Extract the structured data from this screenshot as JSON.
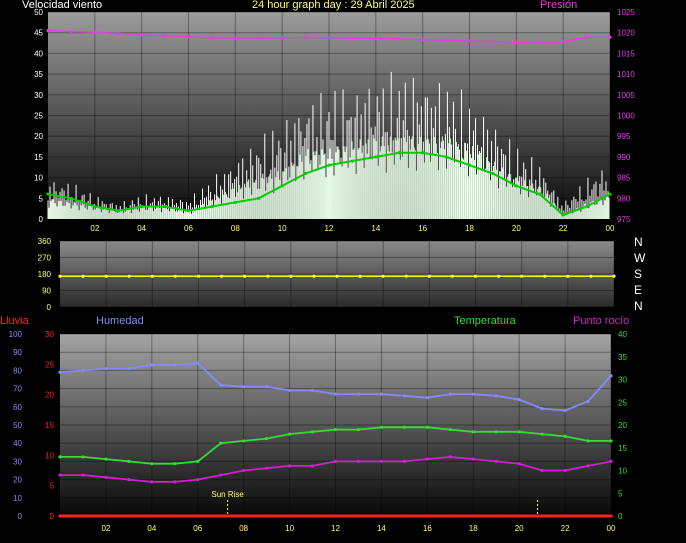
{
  "header": {
    "title": "24 hour graph day : 29 Abril 2025",
    "left_label": "Velocidad viento",
    "right_label": "Presión"
  },
  "labels": {
    "lluvia": "Lluvia",
    "humedad": "Humedad",
    "temperatura": "Temperatura",
    "punto_rocio": "Punto rocío",
    "sunrise": "Sun Rise"
  },
  "colors": {
    "background": "#000000",
    "title": "#ffff66",
    "pressure": "#e040e0",
    "gust": "#ffffff",
    "wind_speed": "#c8f0c8",
    "wind_avg": "#00cc00",
    "direction": "#ffff00",
    "lluvia": "#ff2020",
    "humedad": "#8888ff",
    "temperatura": "#33dd33",
    "punto_rocio": "#d020d0",
    "tick_labels": "#ffff66"
  },
  "compass": [
    "N",
    "W",
    "S",
    "E",
    "N"
  ],
  "chart_data": [
    {
      "type": "line",
      "title": "24 hour graph day : 29 Abril 2025",
      "x_ticks": [
        "02",
        "04",
        "06",
        "08",
        "10",
        "12",
        "14",
        "16",
        "18",
        "20",
        "22",
        "00"
      ],
      "x_hours": [
        0,
        1,
        2,
        3,
        4,
        5,
        6,
        7,
        8,
        9,
        10,
        11,
        12,
        13,
        14,
        15,
        16,
        17,
        18,
        19,
        20,
        21,
        22,
        23,
        24
      ],
      "y_left": {
        "label": "Velocidad viento",
        "ylim": [
          0,
          50
        ],
        "ticks": [
          0,
          5,
          10,
          15,
          20,
          25,
          30,
          35,
          40,
          45,
          50
        ]
      },
      "y_right": {
        "label": "Presión",
        "ylim": [
          975,
          1025
        ],
        "ticks": [
          975,
          980,
          985,
          990,
          995,
          1000,
          1005,
          1010,
          1015,
          1020,
          1025
        ]
      },
      "series": [
        {
          "name": "Presión",
          "axis": "right",
          "values": [
            1020.5,
            1020.3,
            1020.1,
            1019.8,
            1019.5,
            1019.3,
            1019.0,
            1018.8,
            1018.7,
            1018.7,
            1018.8,
            1018.9,
            1018.8,
            1018.7,
            1018.6,
            1018.5,
            1018.3,
            1018.2,
            1018.0,
            1017.9,
            1017.7,
            1017.6,
            1017.8,
            1018.9,
            1018.9
          ]
        },
        {
          "name": "Velocidad viento",
          "axis": "left",
          "values": [
            5,
            4,
            3,
            2,
            3,
            3,
            2,
            5,
            8,
            10,
            12,
            17,
            17,
            19,
            20,
            20,
            20,
            20,
            18,
            14,
            10,
            8,
            1,
            4,
            6
          ]
        },
        {
          "name": "Velocidad viento",
          "axis": "left",
          "values": [
            6,
            5,
            3,
            2,
            3,
            3,
            2,
            3,
            4,
            5,
            8,
            11,
            13,
            14,
            15,
            16,
            16,
            15,
            13,
            11,
            8,
            6,
            1,
            3,
            6
          ]
        },
        {
          "name": "Velocidad viento",
          "axis": "left",
          "values": [
            10,
            9,
            6,
            4,
            6,
            6,
            5,
            10,
            15,
            20,
            24,
            30,
            32,
            33,
            35,
            36,
            36,
            34,
            30,
            25,
            18,
            14,
            4,
            10,
            14
          ]
        }
      ]
    },
    {
      "type": "line",
      "x_ticks": [],
      "y_left": {
        "ylim": [
          0,
          360
        ],
        "ticks": [
          0,
          90,
          180,
          270,
          360
        ]
      },
      "series": [
        {
          "name": "Dirección",
          "values": [
            168,
            168,
            168,
            168,
            168,
            168,
            168,
            168,
            168,
            168,
            168,
            168,
            168,
            168,
            168,
            168,
            168,
            168,
            168,
            168,
            168,
            168,
            168,
            168,
            168
          ]
        }
      ]
    },
    {
      "type": "line",
      "x_ticks": [
        "02",
        "04",
        "06",
        "08",
        "10",
        "12",
        "14",
        "16",
        "18",
        "20",
        "22",
        "00"
      ],
      "x_hours": [
        0,
        1,
        2,
        3,
        4,
        5,
        6,
        7,
        8,
        9,
        10,
        11,
        12,
        13,
        14,
        15,
        16,
        17,
        18,
        19,
        20,
        21,
        22,
        23,
        24
      ],
      "y_axes": {
        "humedad": {
          "label": "Humedad",
          "ylim": [
            0,
            100
          ],
          "ticks": [
            0,
            10,
            20,
            30,
            40,
            50,
            60,
            70,
            80,
            90,
            100
          ]
        },
        "lluvia": {
          "label": "Lluvia",
          "ylim": [
            0,
            30
          ],
          "ticks": [
            0,
            5,
            10,
            15,
            20,
            25,
            30
          ]
        },
        "temperatura": {
          "label": "Temperatura",
          "ylim": [
            0,
            40
          ],
          "ticks": [
            0,
            5,
            10,
            15,
            20,
            25,
            30,
            35,
            40
          ]
        }
      },
      "annotations": [
        {
          "text": "Sun Rise",
          "x_hour": 7.3
        },
        {
          "text": "",
          "x_hour": 20.8
        }
      ],
      "series": [
        {
          "name": "Humedad",
          "axis": "humedad",
          "values": [
            79,
            80,
            81,
            81,
            83,
            83,
            84,
            72,
            71,
            71,
            69,
            69,
            67,
            67,
            67,
            66,
            65,
            67,
            67,
            66,
            64,
            59,
            58,
            63,
            77
          ]
        },
        {
          "name": "Temperatura",
          "axis": "temperatura",
          "values": [
            13,
            13,
            12.5,
            12,
            11.5,
            11.5,
            12,
            16,
            16.5,
            17,
            18,
            18.5,
            19,
            19,
            19.5,
            19.5,
            19.5,
            19,
            18.5,
            18.5,
            18.5,
            18,
            17.5,
            16.5,
            16.5
          ]
        },
        {
          "name": "Punto rocío",
          "axis": "temperatura",
          "values": [
            9,
            9,
            8.5,
            8,
            7.5,
            7.5,
            8,
            9,
            10,
            10.5,
            11,
            11,
            12,
            12,
            12,
            12,
            12.5,
            13,
            12.5,
            12,
            11.5,
            10,
            10,
            11,
            12
          ]
        },
        {
          "name": "Lluvia",
          "axis": "lluvia",
          "values": [
            0,
            0,
            0,
            0,
            0,
            0,
            0,
            0,
            0,
            0,
            0,
            0,
            0,
            0,
            0,
            0,
            0,
            0,
            0,
            0,
            0,
            0,
            0,
            0,
            0
          ]
        }
      ]
    }
  ]
}
